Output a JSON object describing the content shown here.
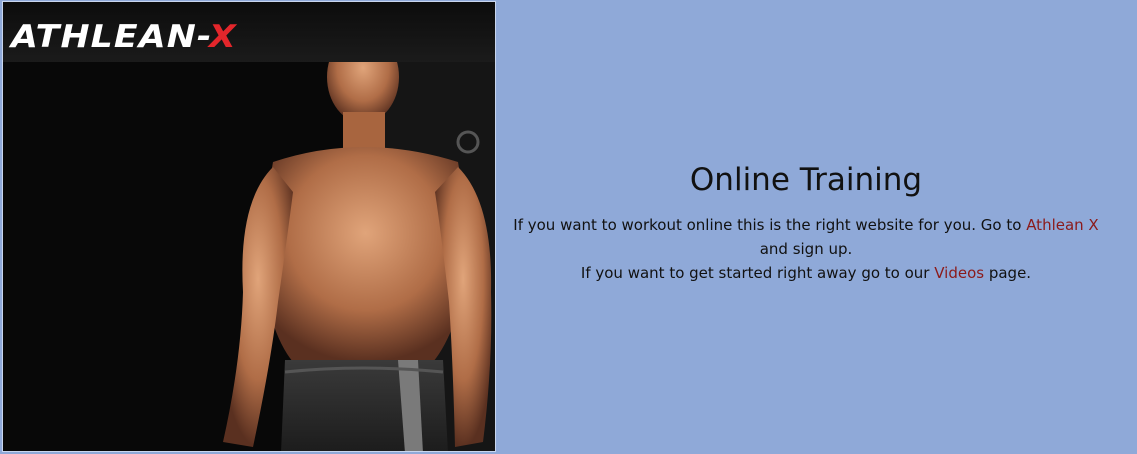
{
  "hero_image": {
    "logo_text_main": "ATHLEAN-",
    "logo_text_accent": "X"
  },
  "main": {
    "heading": "Online Training",
    "paragraph1": {
      "before_link": "If you want to workout online this is the right website for you. Go to ",
      "link_text": "Athlean X",
      "after_link": " and sign up."
    },
    "paragraph2": {
      "before_link": "If you want to get started right away go to our ",
      "link_text": "Videos",
      "after_link": " page."
    }
  },
  "colors": {
    "background": "#8fa9d8",
    "link": "#8b1a1a",
    "logo_accent": "#e3262b"
  }
}
